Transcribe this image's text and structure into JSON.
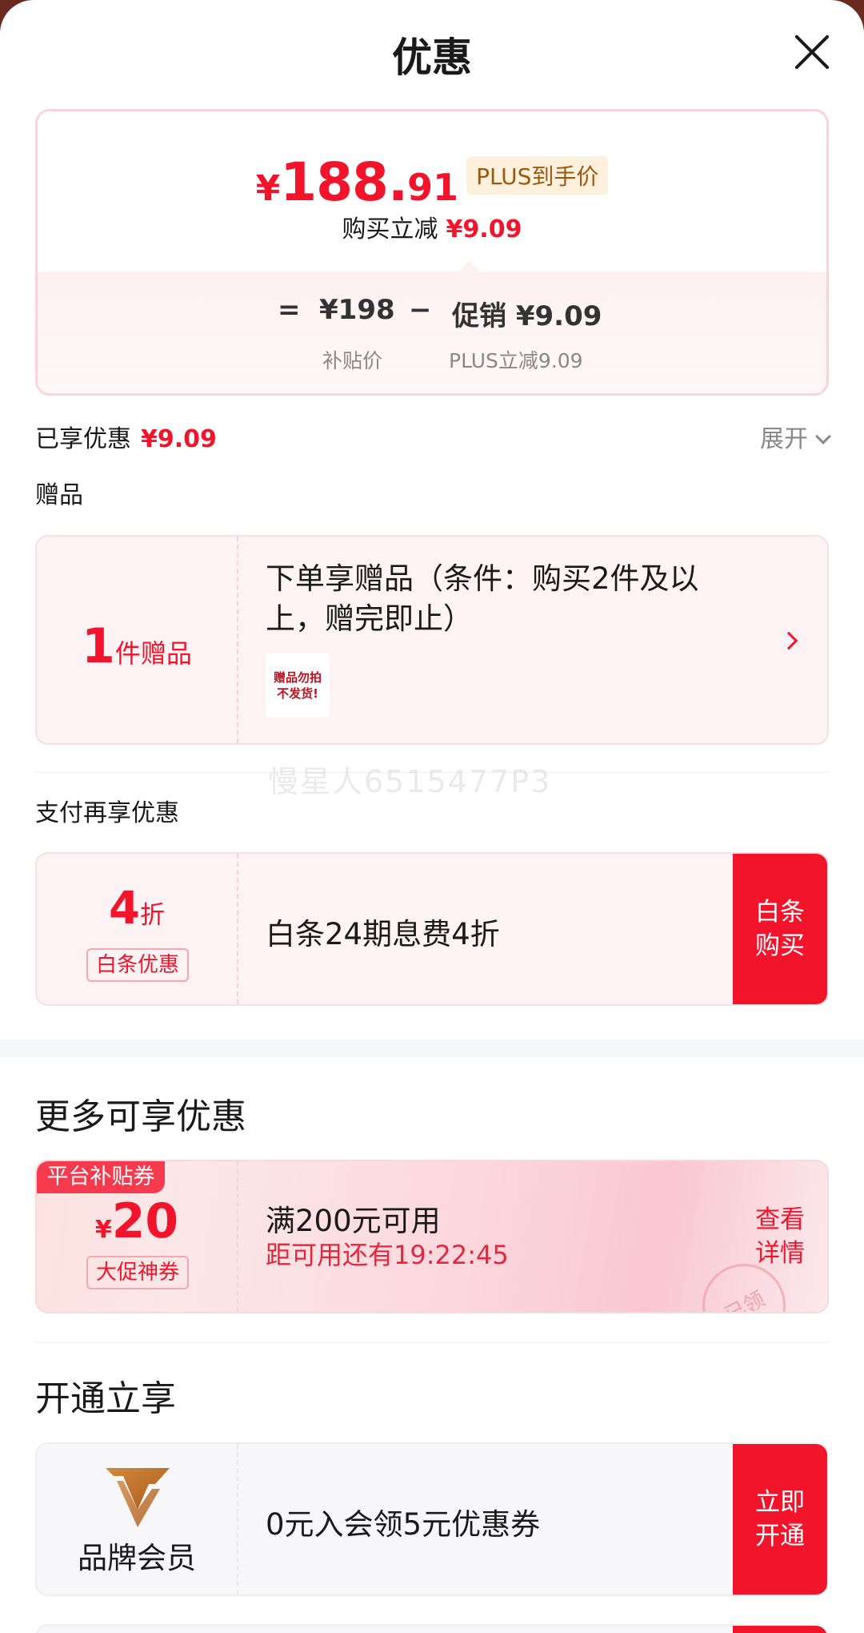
{
  "header": {
    "title": "优惠"
  },
  "price": {
    "yen": "¥",
    "integer": "188.",
    "decimal": "91",
    "tag": "PLUS到手价",
    "direct_label": "购买立减",
    "direct_value": "¥9.09",
    "eq": "=",
    "base_value": "¥198",
    "base_label": "补贴价",
    "minus": "−",
    "promo_value": "促销 ¥9.09",
    "promo_label": "PLUS立减9.09"
  },
  "enjoyed": {
    "label": "已享优惠",
    "value": "¥9.09",
    "expand": "展开"
  },
  "gift": {
    "section": "赠品",
    "count_num": "1",
    "count_unit": "件赠品",
    "desc": "下单享赠品（条件：购买2件及以上，赠完即止）",
    "thumb_line1": "赠品勿拍",
    "thumb_line2": "不发货!"
  },
  "watermark": "慢星人6515477P3",
  "pay": {
    "section": "支付再享优惠",
    "num": "4",
    "unit": "折",
    "tag": "白条优惠",
    "desc": "白条24期息费4折",
    "button": "白条购买"
  },
  "more": {
    "title": "更多可享优惠",
    "badge": "平台补贴券",
    "yen": "¥",
    "amount": "20",
    "tag": "大促神券",
    "condition": "满200元可用",
    "timer": "距可用还有19:22:45",
    "button": "查看详情",
    "stamp": "已领"
  },
  "open": {
    "title": "开通立享",
    "name": "品牌会员",
    "desc": "0元入会领5元优惠券",
    "button": "立即开通"
  },
  "colors": {
    "accent": "#f2142a",
    "gold": "#b86e28"
  }
}
